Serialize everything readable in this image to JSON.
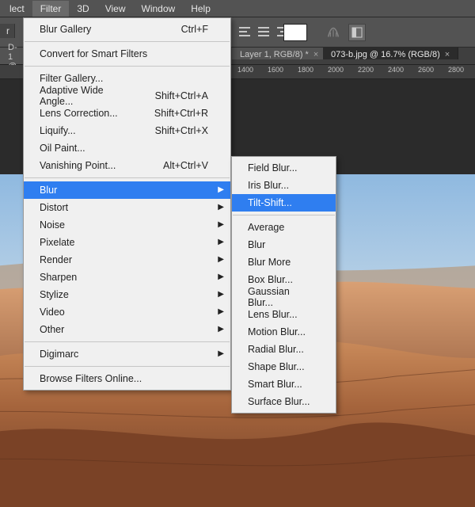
{
  "menubar": {
    "items": [
      "lect",
      "Filter",
      "3D",
      "View",
      "Window",
      "Help"
    ],
    "open_index": 1
  },
  "optionsbar": {
    "left_fragment": "r"
  },
  "tabs": [
    {
      "label": "D-1 @",
      "active": false
    },
    {
      "label": "Layer 1, RGB/8) *",
      "active": false
    },
    {
      "label": "073-b.jpg @ 16.7% (RGB/8)",
      "active": true
    }
  ],
  "ruler": {
    "marks": [
      1400,
      1600,
      1800,
      2000,
      2200,
      2400,
      2600,
      2800
    ]
  },
  "filter_menu": {
    "last": {
      "label": "Blur Gallery",
      "shortcut": "Ctrl+F"
    },
    "convert": "Convert for Smart Filters",
    "group1": [
      {
        "label": "Filter Gallery..."
      },
      {
        "label": "Adaptive Wide Angle...",
        "shortcut": "Shift+Ctrl+A"
      },
      {
        "label": "Lens Correction...",
        "shortcut": "Shift+Ctrl+R"
      },
      {
        "label": "Liquify...",
        "shortcut": "Shift+Ctrl+X"
      },
      {
        "label": "Oil Paint..."
      },
      {
        "label": "Vanishing Point...",
        "shortcut": "Alt+Ctrl+V"
      }
    ],
    "group2": [
      {
        "label": "Blur",
        "sub": true,
        "hover": true
      },
      {
        "label": "Distort",
        "sub": true
      },
      {
        "label": "Noise",
        "sub": true
      },
      {
        "label": "Pixelate",
        "sub": true
      },
      {
        "label": "Render",
        "sub": true
      },
      {
        "label": "Sharpen",
        "sub": true
      },
      {
        "label": "Stylize",
        "sub": true
      },
      {
        "label": "Video",
        "sub": true
      },
      {
        "label": "Other",
        "sub": true
      }
    ],
    "digimarc": {
      "label": "Digimarc",
      "sub": true
    },
    "browse": "Browse Filters Online..."
  },
  "blur_submenu": {
    "group1": [
      {
        "label": "Field Blur..."
      },
      {
        "label": "Iris Blur..."
      },
      {
        "label": "Tilt-Shift...",
        "hover": true
      }
    ],
    "group2": [
      {
        "label": "Average"
      },
      {
        "label": "Blur"
      },
      {
        "label": "Blur More"
      },
      {
        "label": "Box Blur..."
      },
      {
        "label": "Gaussian Blur..."
      },
      {
        "label": "Lens Blur..."
      },
      {
        "label": "Motion Blur..."
      },
      {
        "label": "Radial Blur..."
      },
      {
        "label": "Shape Blur..."
      },
      {
        "label": "Smart Blur..."
      },
      {
        "label": "Surface Blur..."
      }
    ]
  }
}
